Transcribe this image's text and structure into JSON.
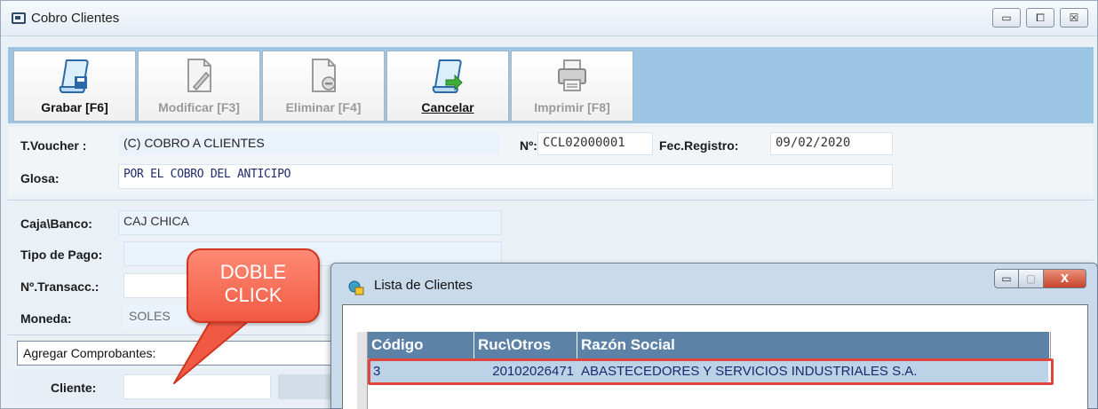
{
  "window": {
    "title": "Cobro Clientes",
    "controls": {
      "minimize": "▭",
      "maximize": "⧠",
      "close": "☒"
    }
  },
  "toolbar": {
    "grabar": "Grabar [F6]",
    "modificar": "Modificar [F3]",
    "eliminar": "Eliminar [F4]",
    "cancelar": "Cancelar",
    "imprimir": "Imprimir [F8]"
  },
  "form": {
    "tvoucher_label": "T.Voucher :",
    "tvoucher_value": "(C) COBRO A CLIENTES",
    "numero_label": "Nº:",
    "numero_value": "CCL02000001",
    "fecha_label": "Fec.Registro:",
    "fecha_value": "09/02/2020",
    "glosa_label": "Glosa:",
    "glosa_value": "POR EL COBRO DEL ANTICIPO",
    "caja_label": "Caja\\Banco:",
    "caja_value": "CAJ CHICA",
    "tipopago_label": "Tipo de Pago:",
    "tipopago_value": "",
    "transacc_label": "Nº.Transacc.:",
    "transacc_value": "",
    "moneda_label": "Moneda:",
    "moneda_value": "SOLES",
    "comprobantes_value": "Agregar Comprobantes:",
    "cliente_label": "Cliente:",
    "cliente_value": ""
  },
  "callout": {
    "line1": "DOBLE",
    "line2": "CLICK"
  },
  "dialog": {
    "title": "Lista de Clientes",
    "controls": {
      "minimize": "▭",
      "maximize": "▢",
      "close": "X"
    },
    "columns": [
      "Código",
      "Ruc\\Otros",
      "Razón Social"
    ],
    "rows": [
      {
        "codigo": "3",
        "ruc": "20102026471",
        "razon": "ABASTECEDORES Y SERVICIOS INDUSTRIALES S.A."
      }
    ]
  },
  "colors": {
    "toolbar_bg": "#9cc4e3",
    "header_bg": "#5d82a8",
    "highlight": "#e0463b",
    "callout": "#f05a44"
  }
}
